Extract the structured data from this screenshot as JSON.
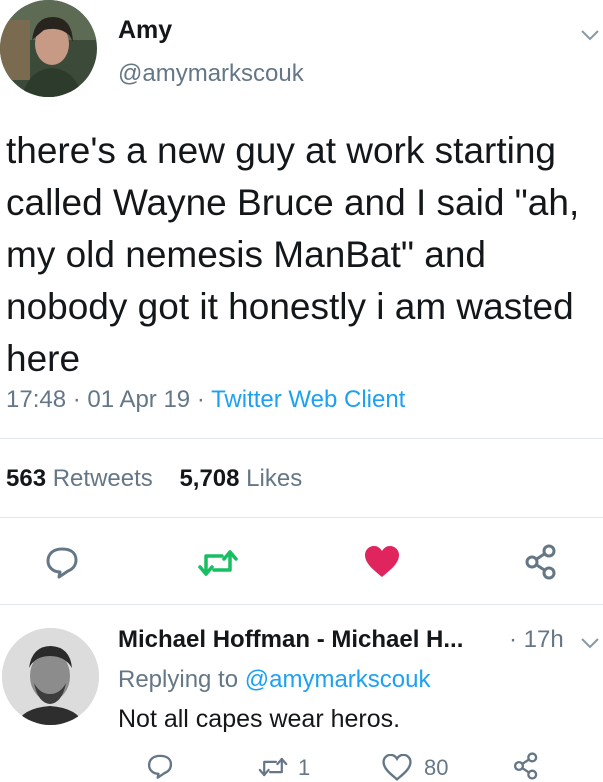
{
  "tweet": {
    "display_name": "Amy",
    "handle": "@amymarkscouk",
    "text": "there's a new guy at work starting called Wayne Bruce and I said \"ah, my old nemesis ManBat\" and nobody got it honestly i am wasted here",
    "time": "17:48",
    "date": "01 Apr 19",
    "sep1": "·",
    "sep2": "·",
    "client": "Twitter Web Client",
    "retweets_count": "563",
    "retweets_label": "Retweets",
    "likes_count": "5,708",
    "likes_label": "Likes"
  },
  "reply": {
    "display_name": "Michael Hoffman - Michael H...",
    "time": "· 17h",
    "replying_prefix": "Replying to",
    "replying_handle": "@amymarkscouk",
    "text": "Not all capes wear heros.",
    "retweet_count": "1",
    "like_count": "80"
  },
  "icons": {
    "reply": "reply-bubble-icon",
    "retweet": "retweet-arrows-icon",
    "like": "heart-icon",
    "share": "share-nodes-icon",
    "menu": "chevron-down-icon"
  },
  "colors": {
    "link": "#1da1f2",
    "retweet_active": "#17bf63",
    "like_active": "#e0245e",
    "secondary_text": "#657786"
  }
}
